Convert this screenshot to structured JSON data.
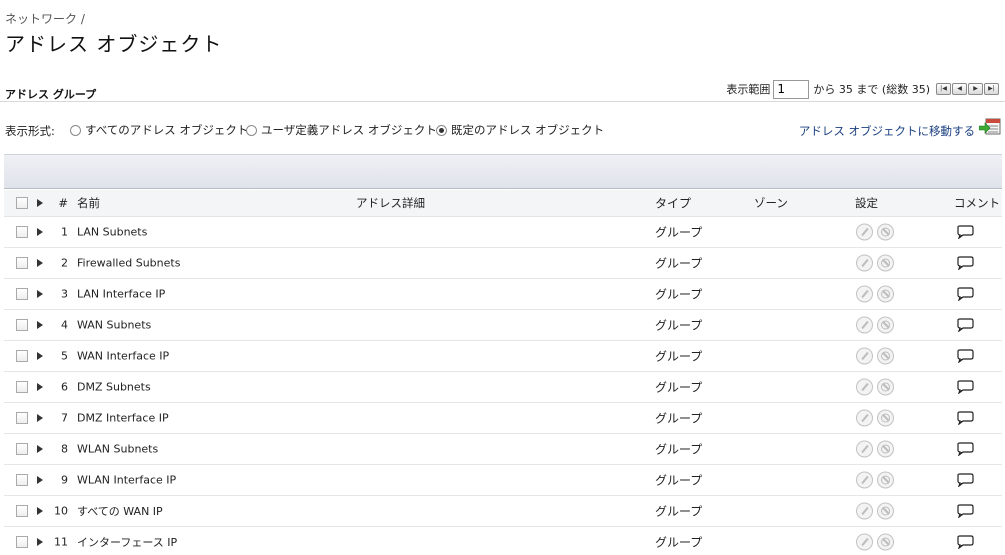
{
  "breadcrumb": "ネットワーク /",
  "page_title": "アドレス オブジェクト",
  "section": {
    "title": "アドレス グループ",
    "pager": {
      "label_before": "表示範囲",
      "value": "1",
      "label_after": "から 35 まで (総数 35)",
      "buttons": [
        "first",
        "prev",
        "next",
        "last"
      ]
    }
  },
  "view": {
    "label": "表示形式:",
    "options": [
      {
        "label": "すべてのアドレス オブジェクト",
        "checked": false
      },
      {
        "label": "ユーザ定義アドレス オブジェクト",
        "checked": false
      },
      {
        "label": "既定のアドレス オブジェクト",
        "checked": true
      }
    ],
    "goto_link": "アドレス オブジェクトに移動する"
  },
  "table": {
    "headers": {
      "num": "#",
      "name": "名前",
      "detail": "アドレス詳細",
      "type": "タイプ",
      "zone": "ゾーン",
      "settings": "設定",
      "comment": "コメント"
    },
    "rows": [
      {
        "num": "1",
        "name": "LAN Subnets",
        "type": "グループ"
      },
      {
        "num": "2",
        "name": "Firewalled Subnets",
        "type": "グループ"
      },
      {
        "num": "3",
        "name": "LAN Interface IP",
        "type": "グループ"
      },
      {
        "num": "4",
        "name": "WAN Subnets",
        "type": "グループ"
      },
      {
        "num": "5",
        "name": "WAN Interface IP",
        "type": "グループ"
      },
      {
        "num": "6",
        "name": "DMZ Subnets",
        "type": "グループ"
      },
      {
        "num": "7",
        "name": "DMZ Interface IP",
        "type": "グループ"
      },
      {
        "num": "8",
        "name": "WLAN Subnets",
        "type": "グループ"
      },
      {
        "num": "9",
        "name": "WLAN Interface IP",
        "type": "グループ"
      },
      {
        "num": "10",
        "name": "すべての WAN IP",
        "type": "グループ"
      },
      {
        "num": "11",
        "name": "インターフェース IP",
        "type": "グループ"
      }
    ]
  },
  "colors": {
    "link": "#1a3f80",
    "header_band": "#dfe3ea"
  }
}
